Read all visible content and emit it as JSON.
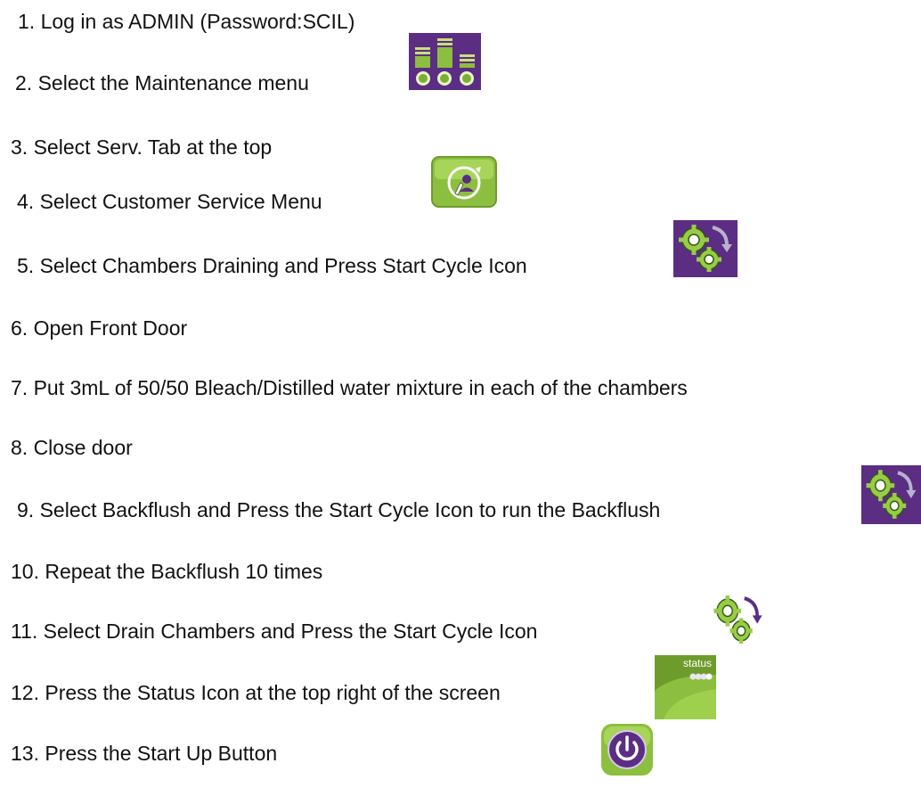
{
  "steps": [
    "1. Log in as ADMIN (Password:SCIL)",
    "2. Select the Maintenance menu",
    "3. Select   Serv. Tab at the top",
    "4. Select Customer Service Menu",
    "5. Select Chambers Draining and Press Start Cycle Icon",
    "6. Open Front Door",
    "7. Put 3mL of 50/50 Bleach/Distilled water mixture in each of the chambers",
    "8. Close door",
    "9. Select  Backflush and Press the Start Cycle Icon to run the Backflush",
    "10. Repeat the Backflush 10 times",
    "11. Select  Drain Chambers and Press the Start Cycle Icon",
    "12. Press the Status Icon at the top right of the screen",
    "13. Press  the Start Up Button"
  ],
  "icons": {
    "maintenance": "maintenance-menu-icon",
    "customer_service": "customer-service-icon",
    "start_cycle": "start-cycle-gears-icon",
    "status": "status-icon",
    "start_up": "power-button-icon",
    "status_label": "status"
  },
  "colors": {
    "purple": "#5b2d83",
    "green": "#8cbf3f"
  }
}
